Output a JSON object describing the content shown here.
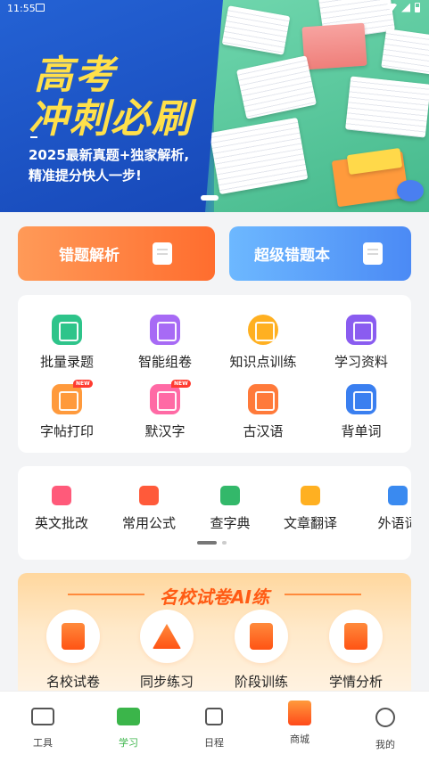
{
  "status_bar": {
    "time": "11:55"
  },
  "banner": {
    "title_line1": "高考",
    "title_line2": "冲刺必刷",
    "subtitle_line1": "2025最新真题+独家解析,",
    "subtitle_line2": "精准提分快人一步!"
  },
  "features": [
    {
      "label": "错题解析",
      "color": "#ff6d2e",
      "icon": "edit-doc-icon"
    },
    {
      "label": "超级错题本",
      "color": "#4b8af5",
      "icon": "notebook-icon"
    }
  ],
  "grid": [
    {
      "label": "批量录题",
      "color": "#2ec48a",
      "icon": "batch-icon",
      "badge": ""
    },
    {
      "label": "智能组卷",
      "color": "#a76af5",
      "icon": "paper-icon",
      "badge": ""
    },
    {
      "label": "知识点训练",
      "color": "#ffb021",
      "icon": "target-icon",
      "badge": ""
    },
    {
      "label": "学习资料",
      "color": "#8a5cf0",
      "icon": "book-icon",
      "badge": ""
    },
    {
      "label": "字帖打印",
      "color": "#ff9a3c",
      "icon": "print-icon",
      "badge": "NEW"
    },
    {
      "label": "默汉字",
      "color": "#ff6aa5",
      "icon": "char-icon",
      "badge": "NEW"
    },
    {
      "label": "古汉语",
      "color": "#ff7a3a",
      "icon": "ancient-icon",
      "badge": ""
    },
    {
      "label": "背单词",
      "color": "#3a7ff0",
      "icon": "word-icon",
      "badge": ""
    }
  ],
  "tools": [
    {
      "label": "英文批改",
      "color": "#ff5a7a",
      "icon": "correct-icon"
    },
    {
      "label": "常用公式",
      "color": "#ff5a3a",
      "icon": "formula-icon"
    },
    {
      "label": "查字典",
      "color": "#33b86a",
      "icon": "dictionary-icon"
    },
    {
      "label": "文章翻译",
      "color": "#ffb021",
      "icon": "translate-icon"
    },
    {
      "label": "外语词",
      "color": "#3a8af0",
      "icon": "foreign-icon"
    }
  ],
  "exam": {
    "title": "名校试卷AI练",
    "items": [
      {
        "label": "名校试卷",
        "icon": "scroll-icon"
      },
      {
        "label": "同步练习",
        "icon": "triangle-icon"
      },
      {
        "label": "阶段训练",
        "icon": "stage-icon"
      },
      {
        "label": "学情分析",
        "icon": "chart-doc-icon"
      }
    ]
  },
  "nav": [
    {
      "label": "工具",
      "icon": "toolbox-icon",
      "active": false
    },
    {
      "label": "学习",
      "icon": "study-book-icon",
      "active": true
    },
    {
      "label": "日程",
      "icon": "calendar-icon",
      "active": false
    },
    {
      "label": "商城",
      "icon": "shop-bag-icon",
      "active": false
    },
    {
      "label": "我的",
      "icon": "profile-icon",
      "active": false
    }
  ]
}
